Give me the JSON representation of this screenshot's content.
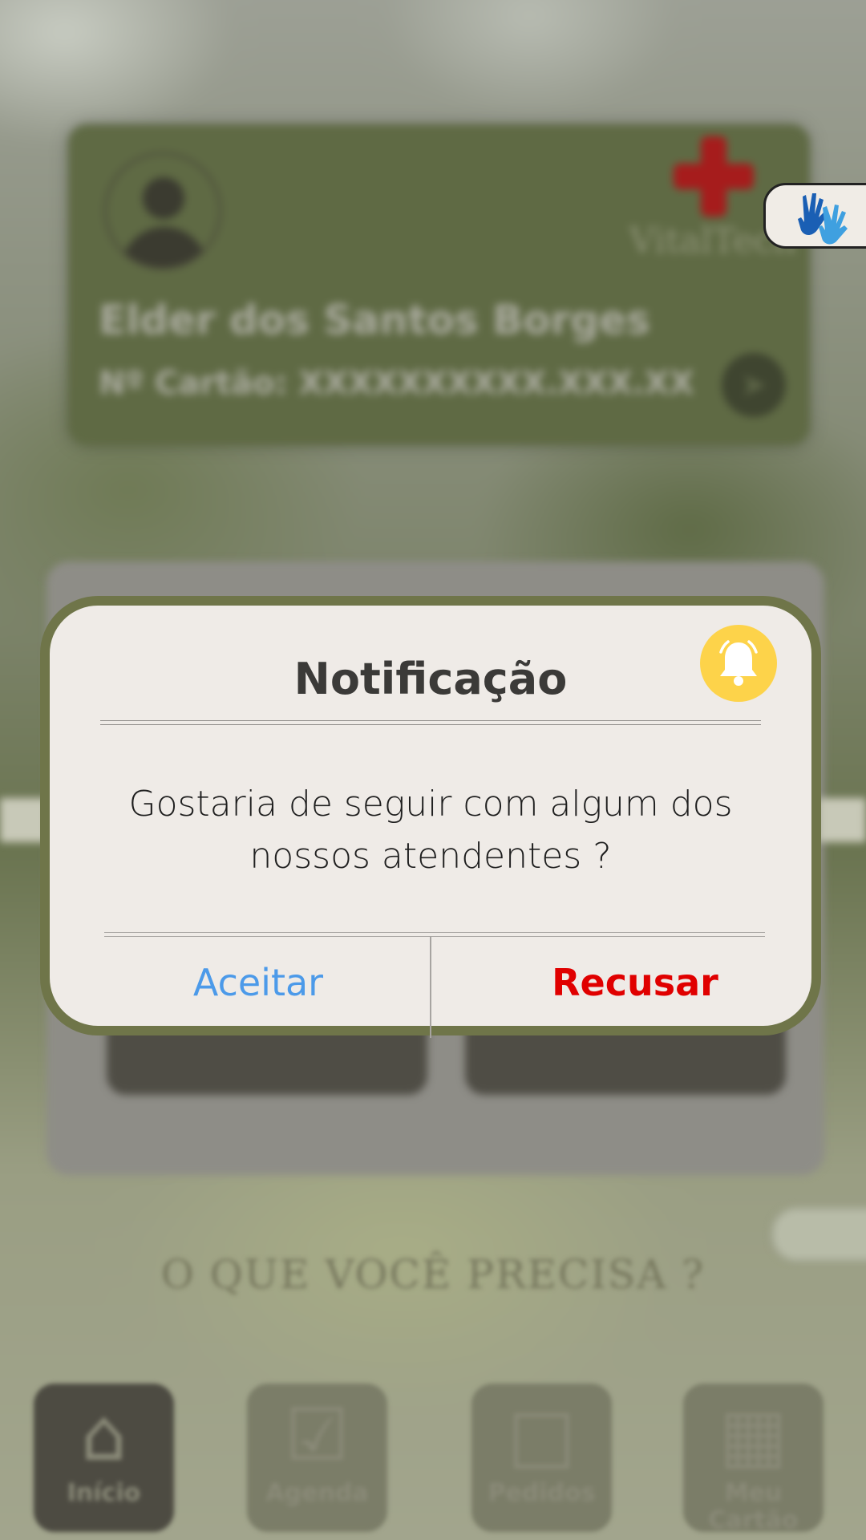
{
  "background": {
    "profile_card": {
      "user_name": "Elder dos Santos Borges",
      "card_number": "Nº Cartão: XXXXXXXXXX.XXX.XX",
      "brand": "VitalTech"
    },
    "question_heading": "O QUE VOCÊ PRECISA ?",
    "bottom_nav": {
      "items": [
        {
          "label": "Início",
          "icon": "home-icon"
        },
        {
          "label": "Agenda",
          "icon": "calendar-icon"
        },
        {
          "label": "Pedidos",
          "icon": "clipboard-icon"
        },
        {
          "label": "Meu Cartão",
          "icon": "id-card-icon"
        }
      ]
    }
  },
  "accessibility_button": {
    "icon": "sign-language-icon"
  },
  "modal": {
    "title": "Notificação",
    "icon": "bell-icon",
    "message": "Gostaria de seguir com algum dos nossos atendentes ?",
    "accept_label": "Aceitar",
    "decline_label": "Recusar"
  },
  "colors": {
    "modal_border": "#6f7549",
    "modal_bg": "#efebe7",
    "accept": "#4c9ae9",
    "decline": "#e00000",
    "bell_badge": "#fdd34a",
    "brand_cross": "#a61c1c"
  }
}
